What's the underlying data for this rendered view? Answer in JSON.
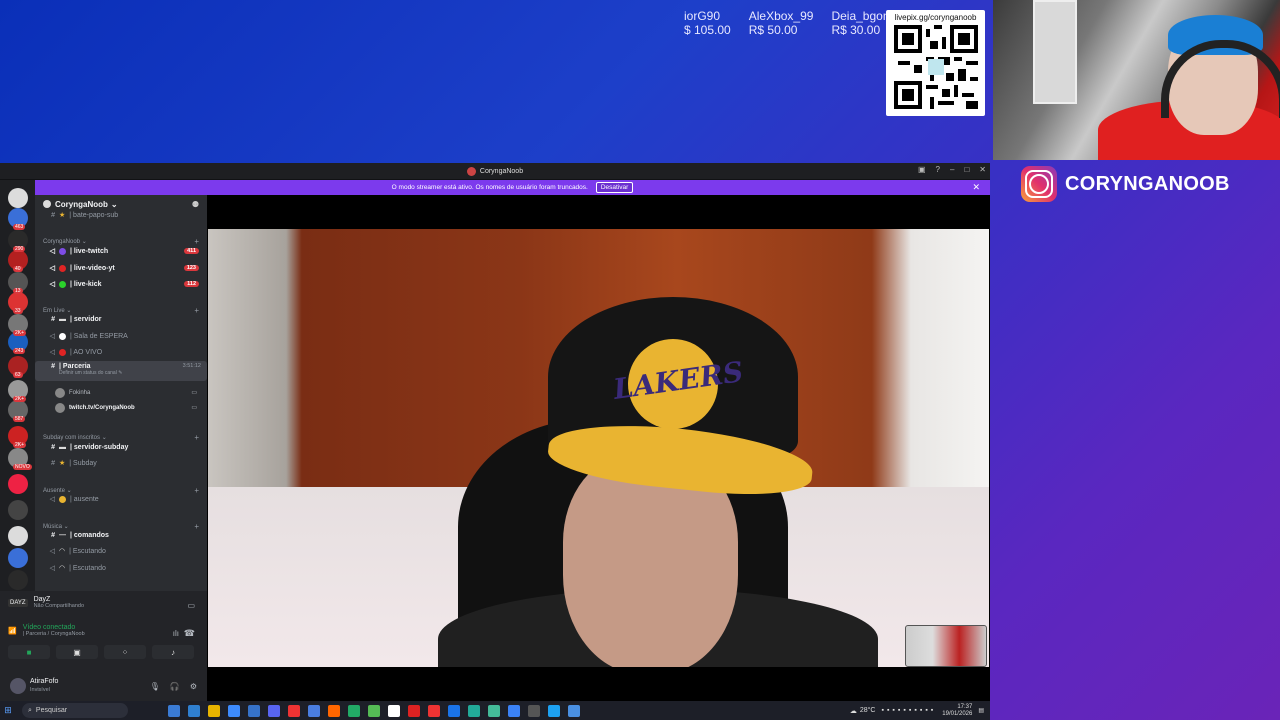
{
  "overlay": {
    "donors": [
      {
        "name": "iorG90",
        "amount": "$ 105.00"
      },
      {
        "name": "AleXbox_99",
        "amount": "R$ 50.00"
      },
      {
        "name": "Deia_bgon",
        "amount": "R$ 30.00"
      }
    ],
    "qr_url": "livepix.gg/corynganoob",
    "instagram": "CORYNGANOOB"
  },
  "window": {
    "title": "CoryngaNoob",
    "streamer_banner": "O modo streamer está ativo. Os nomes de usuário foram truncados.",
    "deactivate_label": "Desativar"
  },
  "guild_badges": [
    "463",
    "290",
    "40",
    "13",
    "33",
    "2K+",
    "243",
    "63",
    "2K+",
    "587",
    "2K+",
    "NOVO"
  ],
  "server": {
    "name": "CoryngaNoob",
    "rows": [
      {
        "kind": "channel",
        "label": "bate-papo-sub",
        "prefix": "★",
        "bold": false
      },
      {
        "kind": "category",
        "label": "CoryngaNoob"
      },
      {
        "kind": "channel",
        "label": "live-twitch",
        "bold": true,
        "dot": "#7e4ce6",
        "badge": "411"
      },
      {
        "kind": "channel",
        "label": "live-video-yt",
        "bold": true,
        "dot": "#e02424",
        "badge": "123"
      },
      {
        "kind": "channel",
        "label": "live-kick",
        "bold": true,
        "dot": "#2bd12b",
        "badge": "112"
      },
      {
        "kind": "category",
        "label": "Em Live"
      },
      {
        "kind": "channel",
        "label": "servidor",
        "bold": true,
        "prefix": "▬"
      },
      {
        "kind": "channel",
        "label": "Sala de ESPERA",
        "dot": "#ffffff"
      },
      {
        "kind": "channel",
        "label": "AO VIVO",
        "dot": "#e02424"
      },
      {
        "kind": "channel",
        "label": "Parceria",
        "bold": true,
        "selected": true,
        "timer": "3:51:12",
        "status": "Definir um status do canal"
      },
      {
        "kind": "voiceuser",
        "label": "Fokinha"
      },
      {
        "kind": "voiceuser",
        "label": "twitch.tv/CoryngaNoob",
        "bold": true
      },
      {
        "kind": "category",
        "label": "Subday com inscritos"
      },
      {
        "kind": "channel",
        "label": "servidor-subday",
        "bold": true,
        "prefix": "▬"
      },
      {
        "kind": "channel",
        "label": "Subday",
        "prefix": "★"
      },
      {
        "kind": "category",
        "label": "Ausente"
      },
      {
        "kind": "channel",
        "label": "ausente",
        "dot": "#e9b431"
      },
      {
        "kind": "category",
        "label": "Música"
      },
      {
        "kind": "channel",
        "label": "comandos",
        "bold": true,
        "prefix": "—"
      },
      {
        "kind": "channel",
        "label": "Escutando",
        "prefix": "◠"
      },
      {
        "kind": "channel",
        "label": "Escutando",
        "prefix": "◠"
      }
    ]
  },
  "activity": {
    "game": "DayZ",
    "status": "Não Compartilhando"
  },
  "voice": {
    "state": "Vídeo conectado",
    "location": "| Parceria / CoryngaNoob"
  },
  "user": {
    "name": "AtiraFofo",
    "status": "Invisível"
  },
  "taskbar": {
    "search": "Pesquisar",
    "temperature": "28°C",
    "time": "17:37",
    "date": "19/01/2026"
  }
}
